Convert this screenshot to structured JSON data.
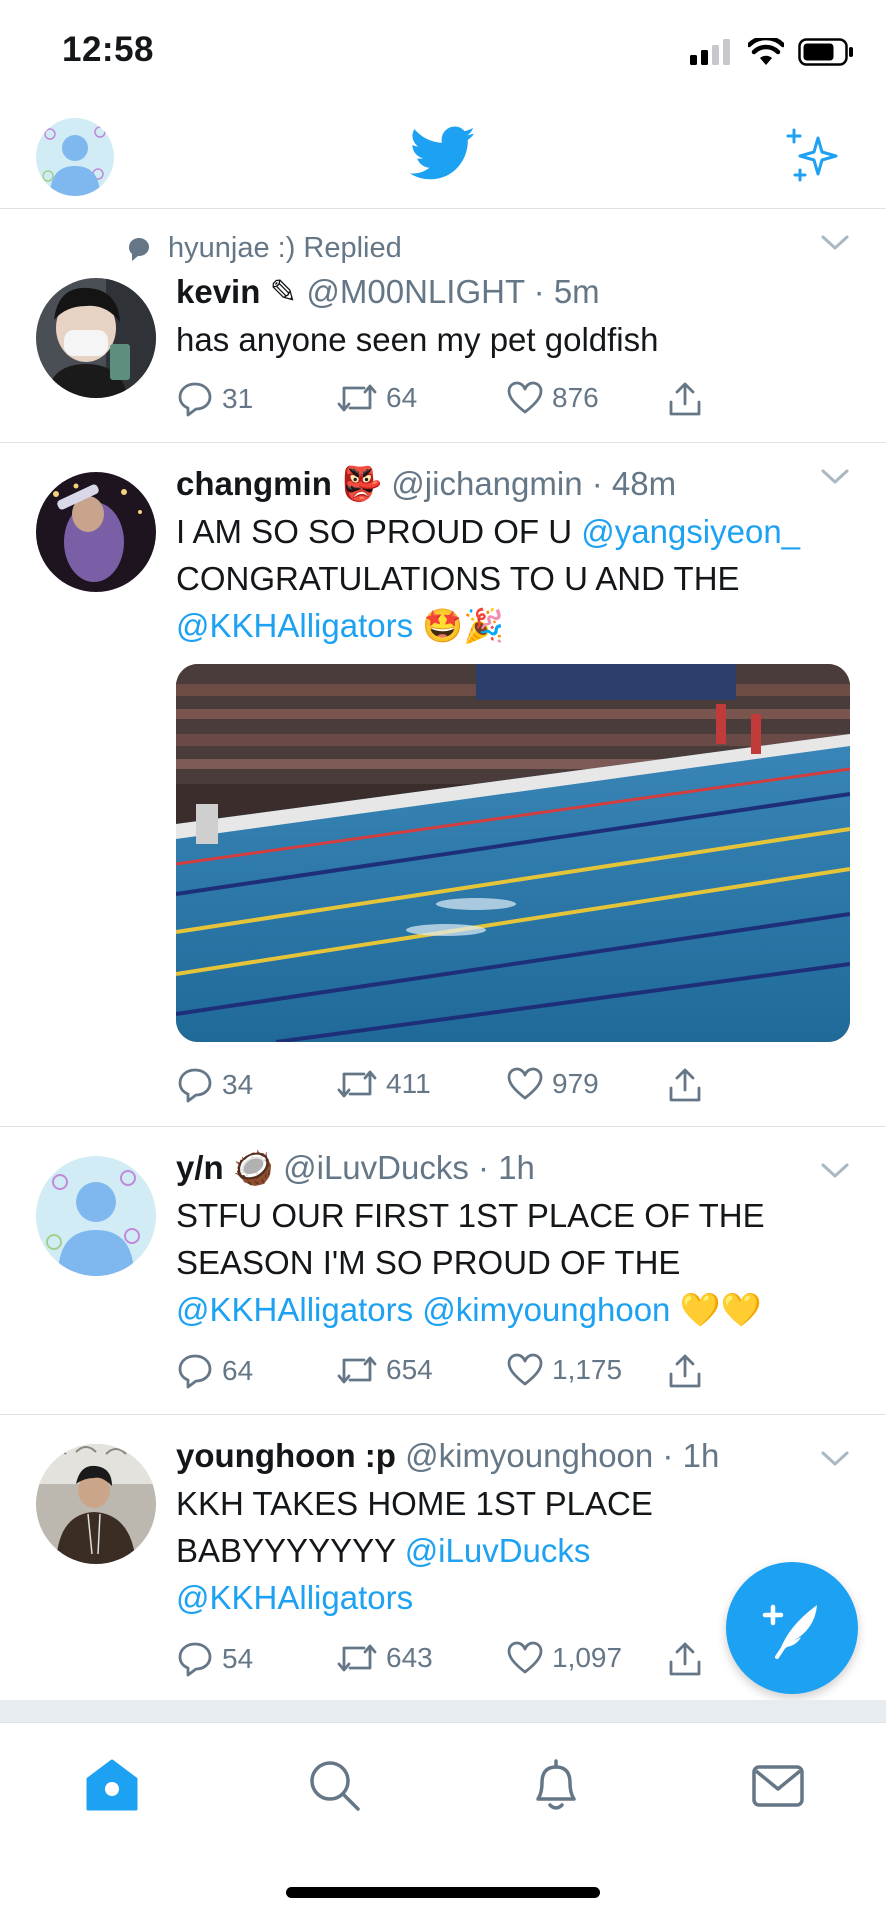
{
  "status_bar": {
    "time": "12:58"
  },
  "colors": {
    "accent": "#1da1f2",
    "secondary_text": "#657786",
    "divider": "#dfe3e6"
  },
  "nav": {
    "logo": "twitter-bird-icon",
    "sparkle": "sparkle-icon"
  },
  "tweets": [
    {
      "social_context": "hyunjae :) Replied",
      "name": "kevin",
      "name_emoji": "✎",
      "handle": "@M00NLIGHT",
      "time": "5m",
      "text": "has anyone seen my pet goldfish",
      "replies": "31",
      "retweets": "64",
      "likes": "876"
    },
    {
      "name": "changmin",
      "name_emoji": "👺",
      "handle": "@jichangmin",
      "time": "48m",
      "text_1": "I AM SO SO PROUD OF U ",
      "link_1": "@yangsiyeon_",
      "text_2": "CONGRATULATIONS TO U AND THE",
      "link_2": "@KKHAlligators",
      "emoji": "🤩🎉",
      "media": "swimming-pool-photo",
      "replies": "34",
      "retweets": "411",
      "likes": "979"
    },
    {
      "name": "y/n",
      "name_emoji": "🥥",
      "handle": "@iLuvDucks",
      "time": "1h",
      "text_1": "STFU OUR FIRST 1ST PLACE OF THE",
      "text_2": "SEASON I'M SO PROUD OF THE",
      "link_1": "@KKHAlligators",
      "link_2": "@kimyounghoon",
      "emoji": "💛💛",
      "replies": "64",
      "retweets": "654",
      "likes": "1,175"
    },
    {
      "name": "younghoon :p",
      "handle": "@kimyounghoon",
      "time": "1h",
      "text_1": "KKH TAKES HOME 1ST PLACE",
      "text_2": "BABYYYYYYY ",
      "link_1": "@iLuvDucks",
      "link_2": "@KKHAlligators",
      "replies": "54",
      "retweets": "643",
      "likes": "1,097"
    }
  ],
  "tabs": [
    "home-icon",
    "search-icon",
    "notifications-icon",
    "messages-icon"
  ]
}
